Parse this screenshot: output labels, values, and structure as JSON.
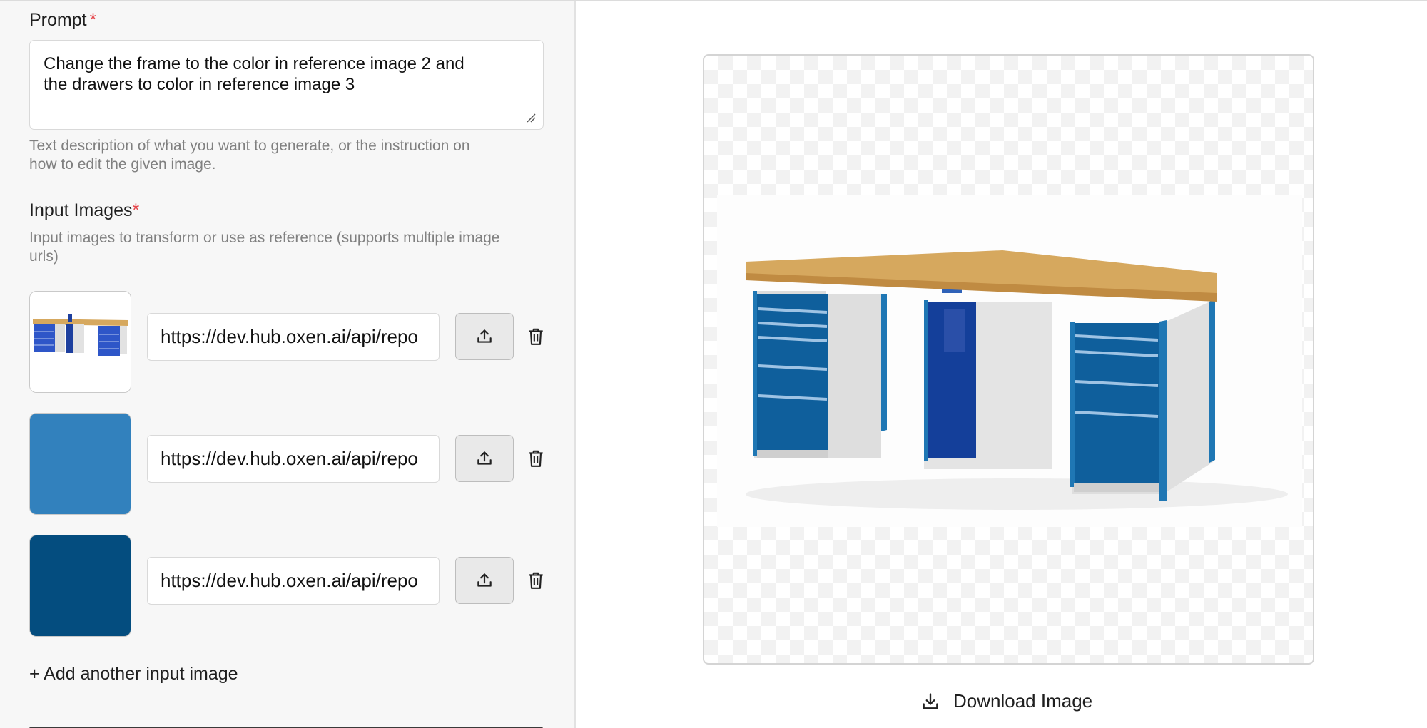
{
  "prompt": {
    "label": "Prompt",
    "required_mark": "*",
    "value_line1": "Change the frame to the color in reference image 2 and",
    "value_line2": "the drawers to color in reference image 3",
    "help_line1": "Text description of what you want to generate, or the instruction on",
    "help_line2": "how to edit the given image."
  },
  "input_images": {
    "label": "Input Images",
    "required_mark": "*",
    "help_line1": "Input images to transform or use as reference (supports multiple image",
    "help_line2": "urls)",
    "items": [
      {
        "url": "https://dev.hub.oxen.ai/api/repo",
        "thumb": "workbench-thumbnail"
      },
      {
        "url": "https://dev.hub.oxen.ai/api/repo",
        "thumb": "color-swatch",
        "color": "#3281bd"
      },
      {
        "url": "https://dev.hub.oxen.ai/api/repo",
        "thumb": "color-swatch",
        "color": "#044d7f"
      }
    ],
    "add_label": "+ Add another input image"
  },
  "output": {
    "download_label": "Download Image"
  },
  "colors": {
    "frame_blue": "#1f77b4",
    "drawer_blue": "#0f5f9c",
    "required": "#e5484d",
    "wood": "#d6a85e"
  }
}
